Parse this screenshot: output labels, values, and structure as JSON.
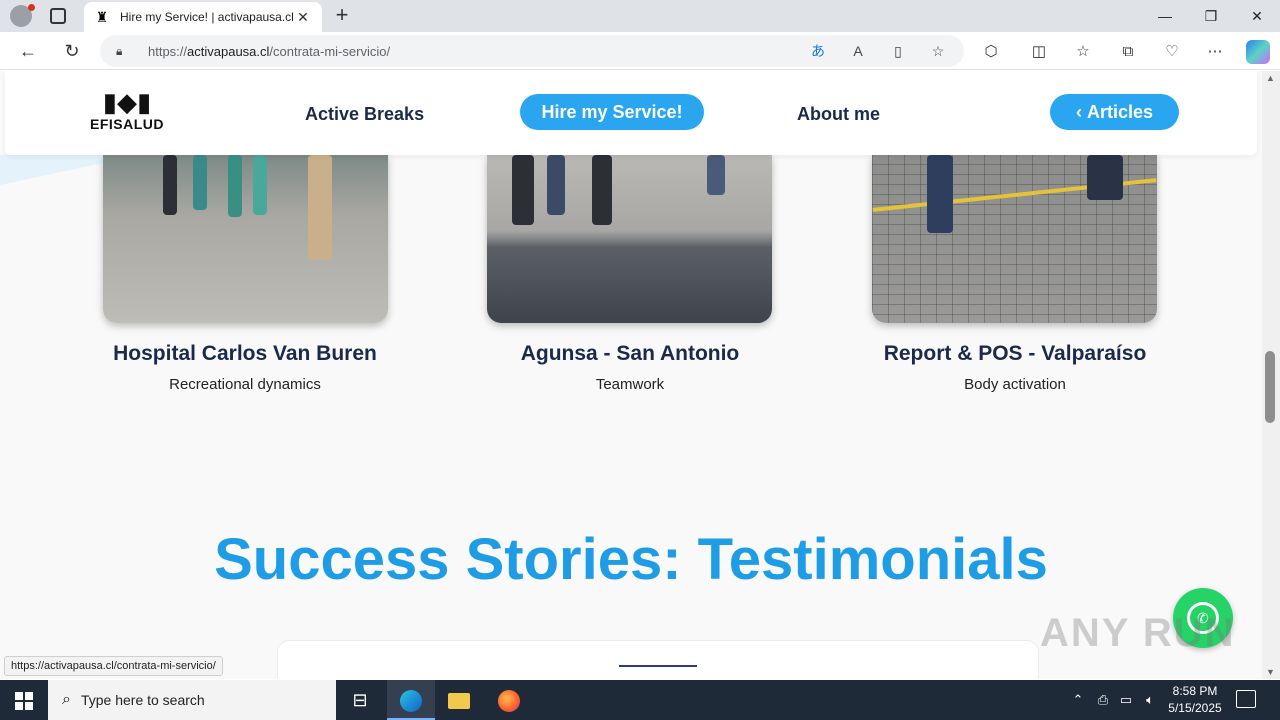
{
  "browser": {
    "tab_title": "Hire my Service! | activapausa.cl",
    "url_prefix": "https://",
    "url_domain": "activapausa.cl",
    "url_path": "/contrata-mi-servicio/",
    "status_url": "https://activapausa.cl/contrata-mi-servicio/"
  },
  "site": {
    "logo_text": "EFISALUD",
    "nav": {
      "active_breaks": "Active Breaks",
      "hire": "Hire my Service!",
      "about": "About me",
      "articles": "Articles"
    }
  },
  "cards": [
    {
      "title": "Hospital Carlos Van Buren",
      "subtitle": "Recreational dynamics"
    },
    {
      "title": "Agunsa - San Antonio",
      "subtitle": "Teamwork"
    },
    {
      "title": "Report & POS - Valparaíso",
      "subtitle": "Body activation"
    }
  ],
  "section": {
    "heading": "Success Stories: Testimonials"
  },
  "watermark": "ANY RUN",
  "taskbar": {
    "search_placeholder": "Type here to search",
    "time": "8:58 PM",
    "date": "5/15/2025"
  },
  "colors": {
    "accent": "#2aa6f0",
    "heading": "#1e9de6",
    "nav_text": "#1b2a4a"
  }
}
